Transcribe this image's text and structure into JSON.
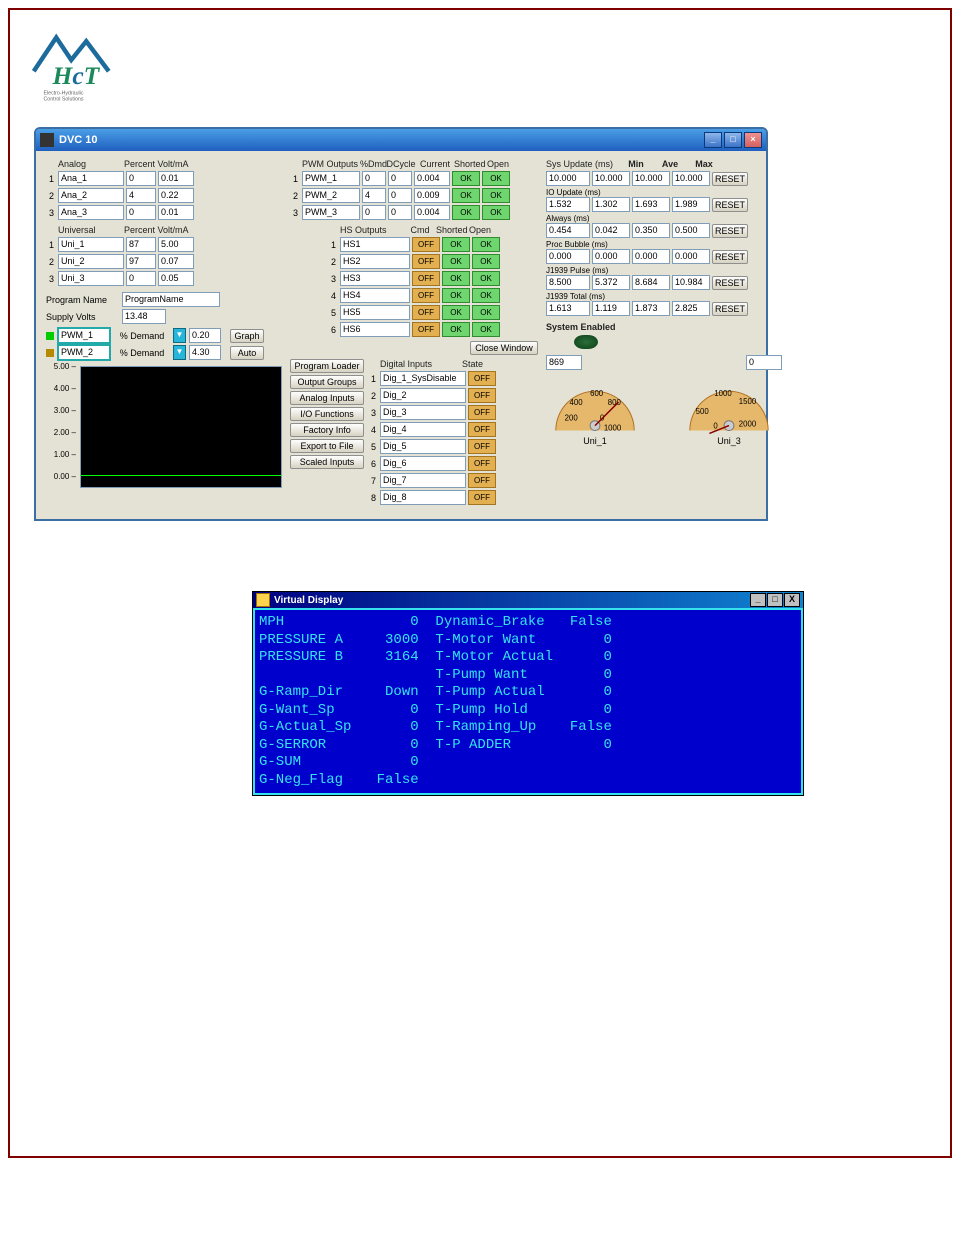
{
  "main": {
    "title": "DVC 10",
    "analog_hdr": "Analog",
    "analog_sub": "Percent Volt/mA",
    "analog": [
      {
        "n": "1",
        "name": "Ana_1",
        "p": "0",
        "v": "0.01"
      },
      {
        "n": "2",
        "name": "Ana_2",
        "p": "4",
        "v": "0.22"
      },
      {
        "n": "3",
        "name": "Ana_3",
        "p": "0",
        "v": "0.01"
      }
    ],
    "uni_hdr": "Universal",
    "uni_sub": "Percent Volt/mA",
    "uni": [
      {
        "n": "1",
        "name": "Uni_1",
        "p": "87",
        "v": "5.00"
      },
      {
        "n": "2",
        "name": "Uni_2",
        "p": "97",
        "v": "0.07"
      },
      {
        "n": "3",
        "name": "Uni_3",
        "p": "0",
        "v": "0.05"
      }
    ],
    "pgm_name_lbl": "Program Name",
    "pgm_name": "ProgramName",
    "supply_lbl": "Supply Volts",
    "supply": "13.48",
    "legend": [
      {
        "name": "PWM_1",
        "x": "% Demand",
        "v": "0.20",
        "c": "#00cc00"
      },
      {
        "name": "PWM_2",
        "x": "% Demand",
        "v": "4.30",
        "c": "#b58900"
      }
    ],
    "plot_btn_graph": "Graph",
    "plot_btn_auto": "Auto",
    "axis": [
      "5.00",
      "4.00",
      "3.00",
      "2.00",
      "1.00",
      "0.00"
    ],
    "pwm_hdr": "PWM Outputs",
    "pwm_cols": [
      "%Dmd",
      "DCycle",
      "Current",
      "Shorted",
      "Open"
    ],
    "pwm": [
      {
        "n": "1",
        "name": "PWM_1",
        "d": "0",
        "dc": "0",
        "c": "0.004"
      },
      {
        "n": "2",
        "name": "PWM_2",
        "d": "4",
        "dc": "0",
        "c": "0.009"
      },
      {
        "n": "3",
        "name": "PWM_3",
        "d": "0",
        "dc": "0",
        "c": "0.004"
      }
    ],
    "hs_hdr": "HS Outputs",
    "hs_cols": [
      "Cmd",
      "Shorted",
      "Open"
    ],
    "hs": [
      {
        "n": "1",
        "name": "HS1"
      },
      {
        "n": "2",
        "name": "HS2"
      },
      {
        "n": "3",
        "name": "HS3"
      },
      {
        "n": "4",
        "name": "HS4"
      },
      {
        "n": "5",
        "name": "HS5"
      },
      {
        "n": "6",
        "name": "HS6"
      }
    ],
    "close_win": "Close Window",
    "sidebtns": [
      "Program Loader",
      "Output Groups",
      "Analog Inputs",
      "I/O Functions",
      "Factory Info",
      "Export to File",
      "Scaled Inputs"
    ],
    "dig_hdr": "Digital Inputs",
    "dig_state": "State",
    "dig": [
      {
        "n": "1",
        "name": "Dig_1_SysDisable"
      },
      {
        "n": "2",
        "name": "Dig_2"
      },
      {
        "n": "3",
        "name": "Dig_3"
      },
      {
        "n": "4",
        "name": "Dig_4"
      },
      {
        "n": "5",
        "name": "Dig_5"
      },
      {
        "n": "6",
        "name": "Dig_6"
      },
      {
        "n": "7",
        "name": "Dig_7"
      },
      {
        "n": "8",
        "name": "Dig_8"
      }
    ],
    "timing_hdr": [
      "Sys Update (ms)",
      "Min",
      "Ave",
      "Max"
    ],
    "timing": [
      {
        "lbl": "",
        "v": "10.000",
        "min": "10.000",
        "ave": "10.000",
        "max": "10.000"
      },
      {
        "lbl": "IO Update (ms)",
        "v": "1.532",
        "min": "1.302",
        "ave": "1.693",
        "max": "1.989"
      },
      {
        "lbl": "Always (ms)",
        "v": "0.454",
        "min": "0.042",
        "ave": "0.350",
        "max": "0.500"
      },
      {
        "lbl": "Proc Bubble (ms)",
        "v": "0.000",
        "min": "0.000",
        "ave": "0.000",
        "max": "0.000"
      },
      {
        "lbl": "J1939 Pulse (ms)",
        "v": "8.500",
        "min": "5.372",
        "ave": "8.684",
        "max": "10.984"
      },
      {
        "lbl": "J1939 Total (ms)",
        "v": "1.613",
        "min": "1.119",
        "ave": "1.873",
        "max": "2.825"
      }
    ],
    "reset": "RESET",
    "sys_en": "System Enabled",
    "g1_lbl": "Uni_1",
    "g1_val": "869",
    "g2_lbl": "Uni_3",
    "g2_val": "0",
    "chart_data": {
      "type": "line",
      "series": [
        {
          "name": "PWM_1",
          "color": "#00cc00",
          "value": 0.2
        },
        {
          "name": "PWM_2",
          "color": "#b58900",
          "value": 4.3
        }
      ],
      "ylim": [
        0,
        5
      ],
      "xlabel": "",
      "ylabel": ""
    }
  },
  "vd": {
    "title": "Virtual Display",
    "rows": [
      [
        "MPH",
        "0",
        "Dynamic_Brake",
        "False"
      ],
      [
        "PRESSURE A",
        "3000",
        "T-Motor Want",
        "0"
      ],
      [
        "PRESSURE B",
        "3164",
        "T-Motor Actual",
        "0"
      ],
      [
        "",
        "",
        "T-Pump Want",
        "0"
      ],
      [
        "G-Ramp_Dir",
        "Down",
        "T-Pump Actual",
        "0"
      ],
      [
        "G-Want_Sp",
        "0",
        "T-Pump Hold",
        "0"
      ],
      [
        "G-Actual_Sp",
        "0",
        "T-Ramping_Up",
        "False"
      ],
      [
        "G-SERROR",
        "0",
        "T-P ADDER",
        "0"
      ],
      [
        "G-SUM",
        "0",
        "",
        ""
      ],
      [
        "G-Neg_Flag",
        "False",
        "",
        ""
      ]
    ]
  }
}
